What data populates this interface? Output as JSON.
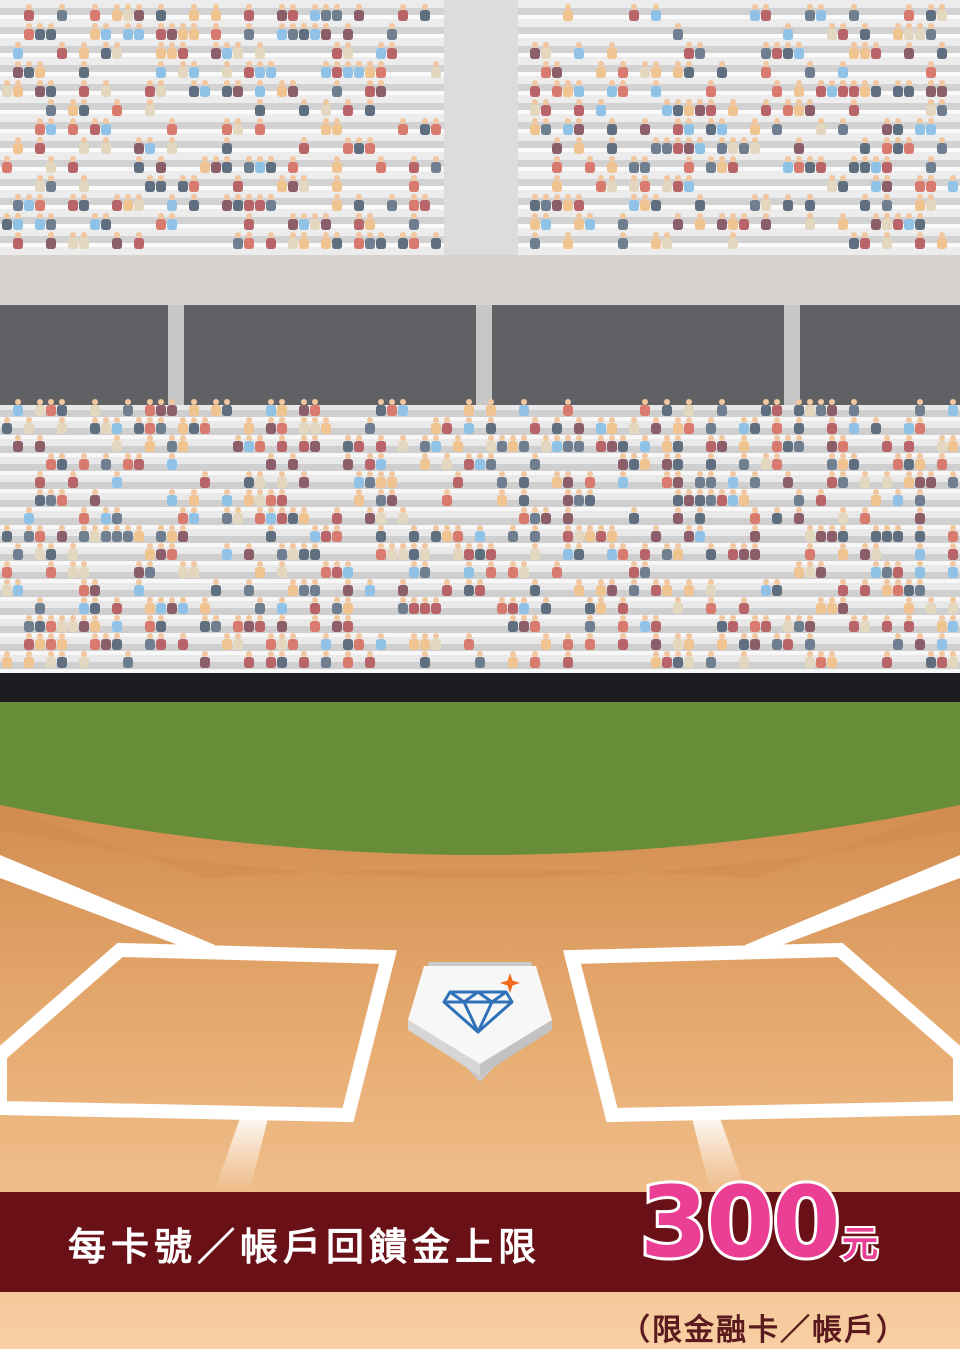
{
  "promo": {
    "headline": "每卡號／帳戶回饋金上限",
    "amount": "300",
    "currency": "元",
    "note": "（限金融卡／帳戶）"
  },
  "colors": {
    "banner": "#6a1118",
    "amount": "#ea3f95",
    "grass": "#688d38",
    "dirt": "#d9975a",
    "background": "#f8cfa3"
  },
  "icons": {
    "home_plate_logo": "diamond-icon",
    "sparkle": "sparkle-icon"
  }
}
